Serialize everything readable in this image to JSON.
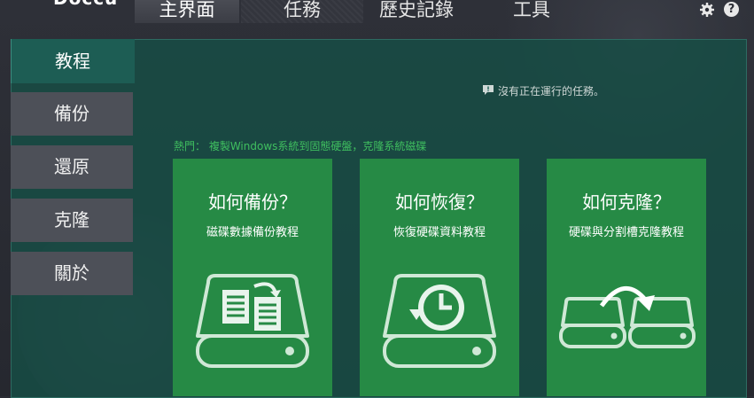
{
  "app": {
    "brand": "Doccu"
  },
  "tabs": [
    {
      "label": "主界面",
      "active": true
    },
    {
      "label": "任務",
      "active": false
    },
    {
      "label": "歷史記錄",
      "active": false
    },
    {
      "label": "工具",
      "active": false
    }
  ],
  "top_icons": {
    "settings": "gear-icon",
    "help": "?"
  },
  "sidebar": {
    "items": [
      {
        "label": "教程",
        "active": true
      },
      {
        "label": "備份"
      },
      {
        "label": "還原"
      },
      {
        "label": "克隆"
      },
      {
        "label": "關於"
      }
    ]
  },
  "status": {
    "text": "沒有正在運行的任務。",
    "icon": "chat-icon"
  },
  "hot": {
    "text": "熱門： 複製Windows系統到固態硬盤，克隆系統磁碟"
  },
  "cards": [
    {
      "title": "如何備份？",
      "subtitle": "磁碟數據備份教程",
      "icon": "backup-drive-icon"
    },
    {
      "title": "如何恢復？",
      "subtitle": "恢復硬碟資料教程",
      "icon": "restore-drive-icon"
    },
    {
      "title": "如何克隆？",
      "subtitle": "硬碟與分割槽克隆教程",
      "icon": "clone-drive-icon"
    }
  ],
  "colors": {
    "accent": "#268a45",
    "panel": "#1d5d54",
    "sidebar": "#4d5058"
  }
}
